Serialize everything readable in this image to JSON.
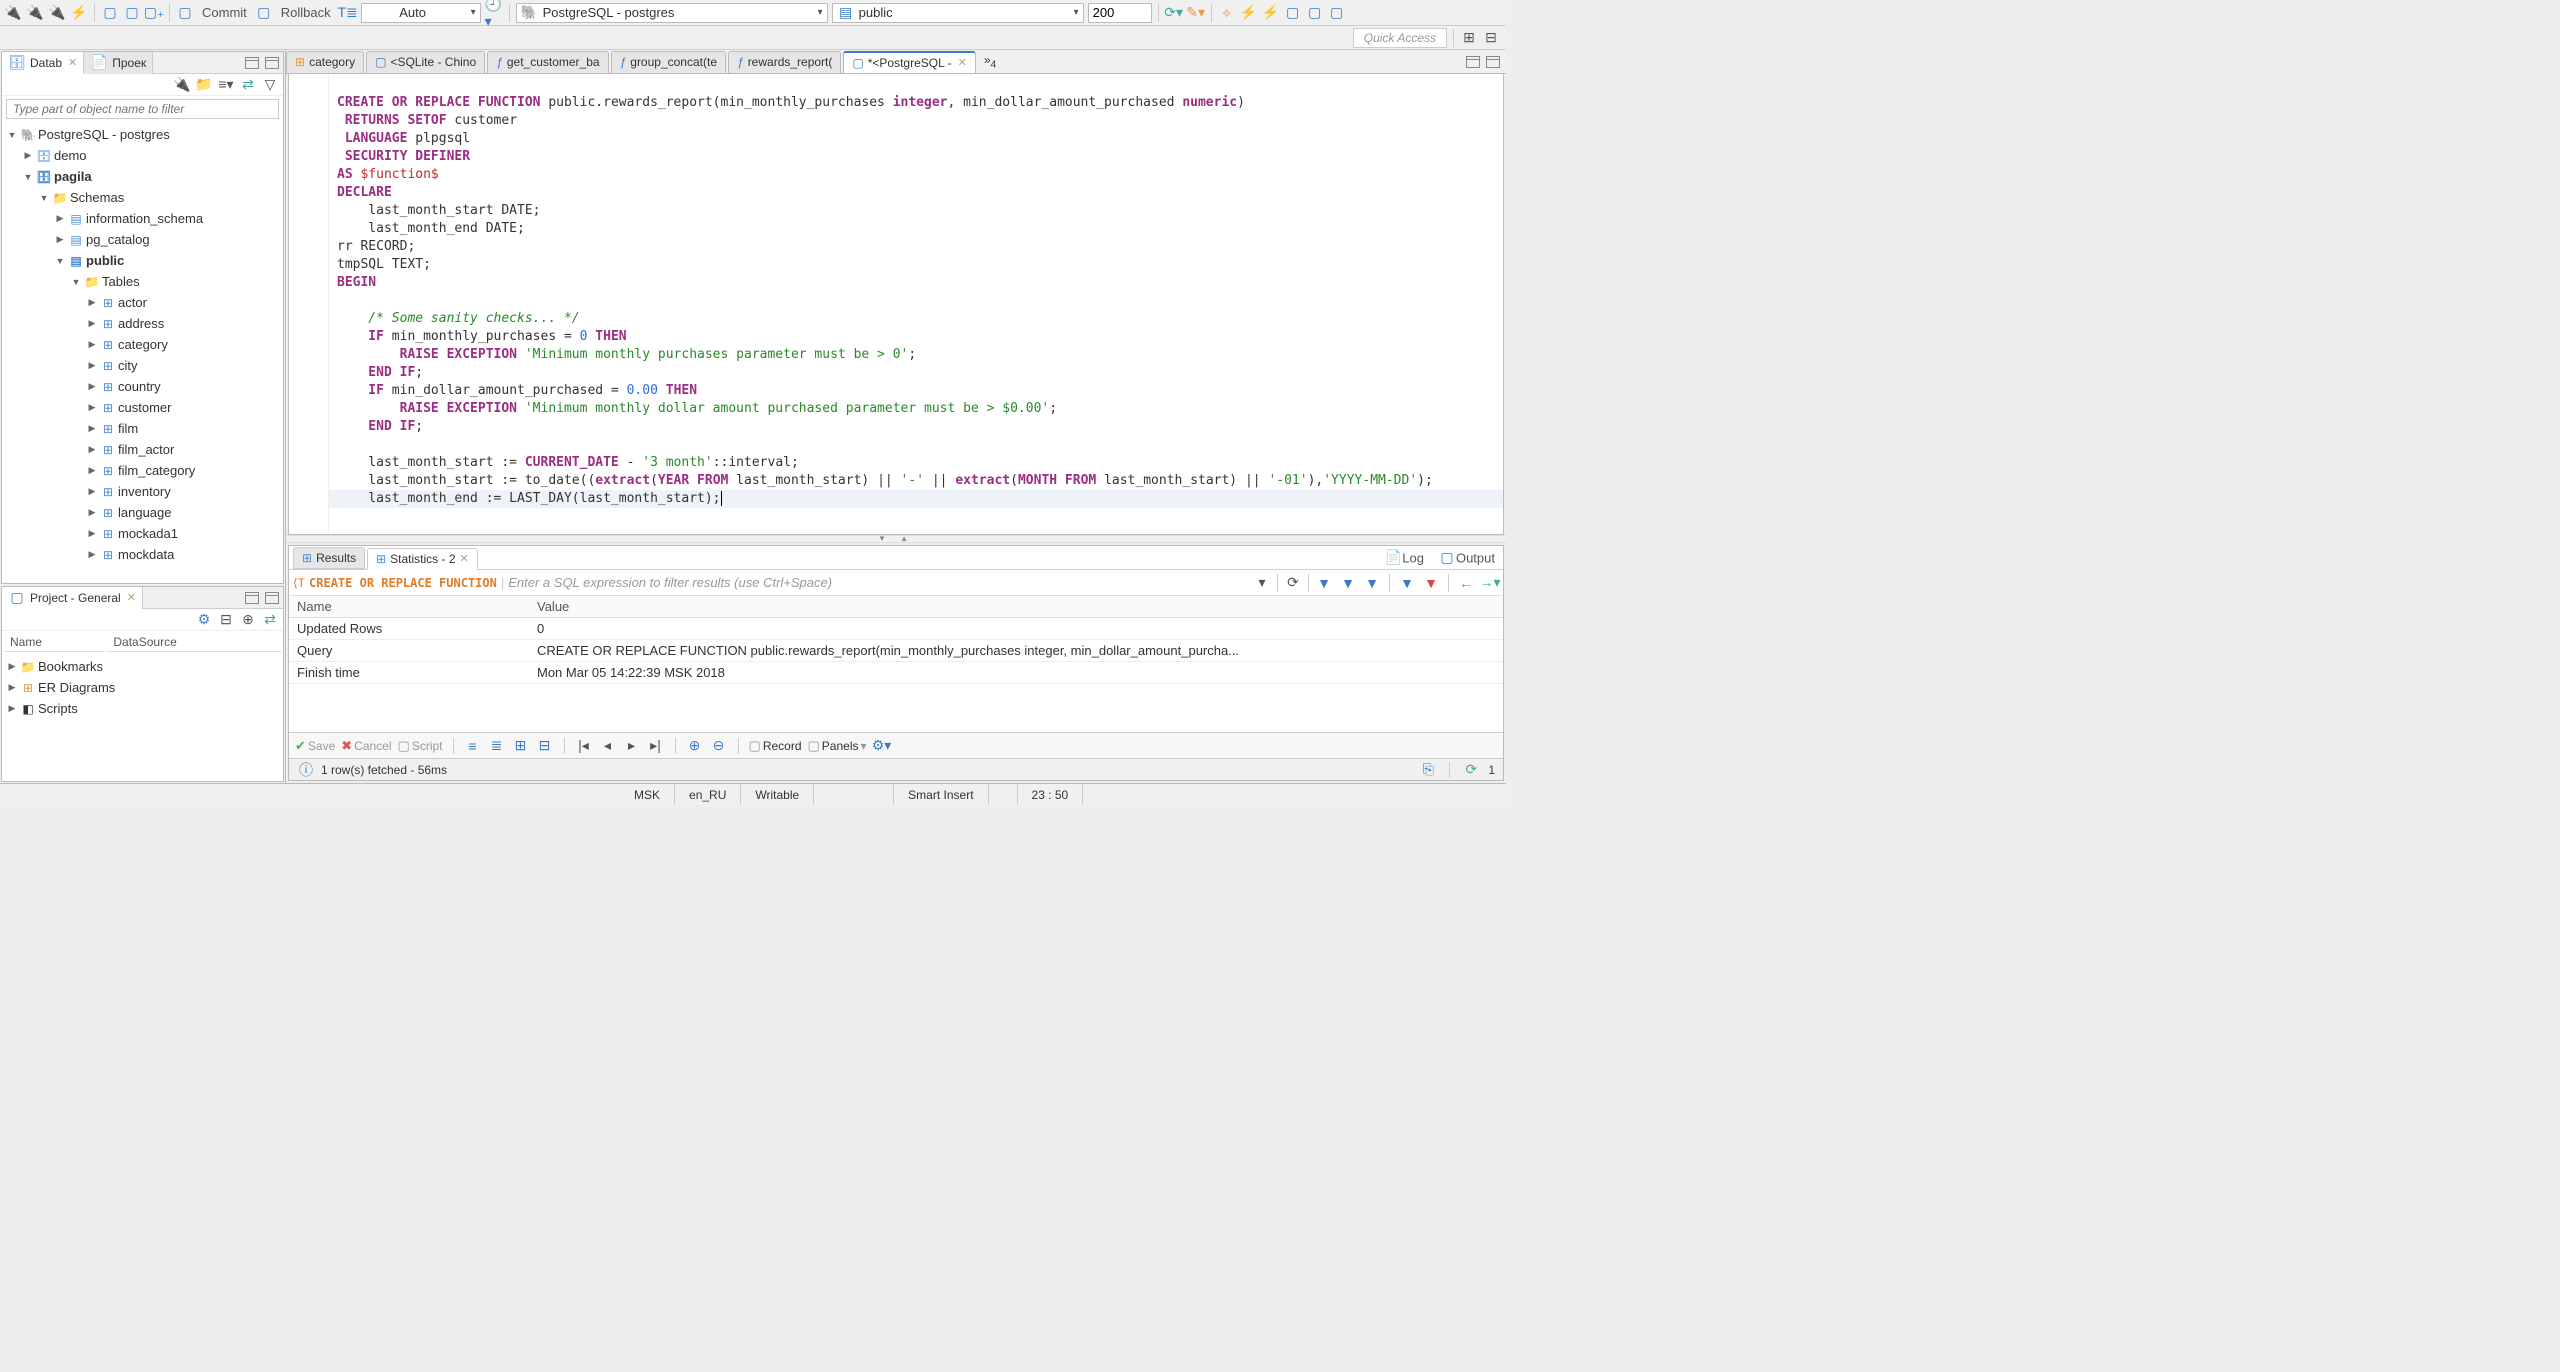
{
  "toolbar": {
    "commit_label": "Commit",
    "rollback_label": "Rollback",
    "tx_mode": "Auto",
    "connection": "PostgreSQL - postgres",
    "schema": "public",
    "limit": "200"
  },
  "quick_access": "Quick Access",
  "left_tabs": {
    "db": "Datab",
    "proj": "Проек"
  },
  "db_filter_placeholder": "Type part of object name to filter",
  "db_tree": {
    "root": "PostgreSQL - postgres",
    "demo": "demo",
    "pagila": "pagila",
    "schemas": "Schemas",
    "info_schema": "information_schema",
    "pg_catalog": "pg_catalog",
    "public": "public",
    "tables": "Tables",
    "t_actor": "actor",
    "t_address": "address",
    "t_category": "category",
    "t_city": "city",
    "t_country": "country",
    "t_customer": "customer",
    "t_film": "film",
    "t_film_actor": "film_actor",
    "t_film_category": "film_category",
    "t_inventory": "inventory",
    "t_language": "language",
    "t_mockada1": "mockada1",
    "t_mockdata": "mockdata"
  },
  "project": {
    "title": "Project - General",
    "col_name": "Name",
    "col_ds": "DataSource",
    "bookmarks": "Bookmarks",
    "er": "ER Diagrams",
    "scripts": "Scripts"
  },
  "editor_tabs": {
    "t1": "category",
    "t2": "<SQLite - Chino",
    "t3": "get_customer_ba",
    "t4": "group_concat(te",
    "t5": "rewards_report(",
    "t6": "*<PostgreSQL -",
    "overflow": "»",
    "overflow_n": "4"
  },
  "code": {
    "l1a": "CREATE OR REPLACE FUNCTION",
    "l1b": " public.rewards_report(min_monthly_purchases ",
    "l1c": "integer",
    "l1d": ", min_dollar_amount_purchased ",
    "l1e": "numeric",
    "l1f": ")",
    "l2a": " RETURNS SETOF",
    "l2b": " customer",
    "l3a": " LANGUAGE",
    "l3b": " plpgsql",
    "l4a": " SECURITY DEFINER",
    "l5a": "AS ",
    "l5b": "$function$",
    "l6a": "DECLARE",
    "l7": "    last_month_start DATE;",
    "l8": "    last_month_end DATE;",
    "l9": "rr RECORD;",
    "l10": "tmpSQL TEXT;",
    "l11a": "BEGIN",
    "l13": "    /* Some sanity checks... */",
    "l14a": "    IF",
    "l14b": " min_monthly_purchases = ",
    "l14c": "0",
    "l14d": " THEN",
    "l15a": "        RAISE EXCEPTION ",
    "l15b": "'Minimum monthly purchases parameter must be > 0'",
    "l15c": ";",
    "l16a": "    END IF",
    "l16b": ";",
    "l17a": "    IF",
    "l17b": " min_dollar_amount_purchased = ",
    "l17c": "0.00",
    "l17d": " THEN",
    "l18a": "        RAISE EXCEPTION ",
    "l18b": "'Minimum monthly dollar amount purchased parameter must be > $0.00'",
    "l18c": ";",
    "l19a": "    END IF",
    "l19b": ";",
    "l21a": "    last_month_start := ",
    "l21b": "CURRENT_DATE",
    "l21c": " - ",
    "l21d": "'3 month'",
    "l21e": "::interval;",
    "l22a": "    last_month_start := to_date((",
    "l22b": "extract",
    "l22c": "(",
    "l22d": "YEAR FROM",
    "l22e": " last_month_start) || ",
    "l22f": "'-'",
    "l22g": " || ",
    "l22h": "extract",
    "l22i": "(",
    "l22j": "MONTH FROM",
    "l22k": " last_month_start) || ",
    "l22l": "'-01'",
    "l22m": "),",
    "l22n": "'YYYY-MM-DD'",
    "l22o": ");",
    "l23": "    last_month_end := LAST_DAY(last_month_start);",
    "l25": "    /*"
  },
  "results": {
    "tab_results": "Results",
    "tab_stats": "Statistics - 2",
    "log": "Log",
    "output": "Output",
    "filter_label": "CREATE OR REPLACE FUNCTION",
    "filter_placeholder": "Enter a SQL expression to filter results (use Ctrl+Space)",
    "col_name": "Name",
    "col_value": "Value",
    "r1n": "Updated Rows",
    "r1v": "0",
    "r2n": "Query",
    "r2v": "CREATE OR REPLACE FUNCTION public.rewards_report(min_monthly_purchases integer, min_dollar_amount_purcha...",
    "r3n": "Finish time",
    "r3v": "Mon Mar 05 14:22:39 MSK 2018"
  },
  "result_footer": {
    "save": "Save",
    "cancel": "Cancel",
    "script": "Script",
    "record": "Record",
    "panels": "Panels",
    "page": "1"
  },
  "status_msg": "1 row(s) fetched - 56ms",
  "status_bar": {
    "tz": "MSK",
    "locale": "en_RU",
    "writable": "Writable",
    "insert": "Smart Insert",
    "pos": "23 : 50"
  }
}
